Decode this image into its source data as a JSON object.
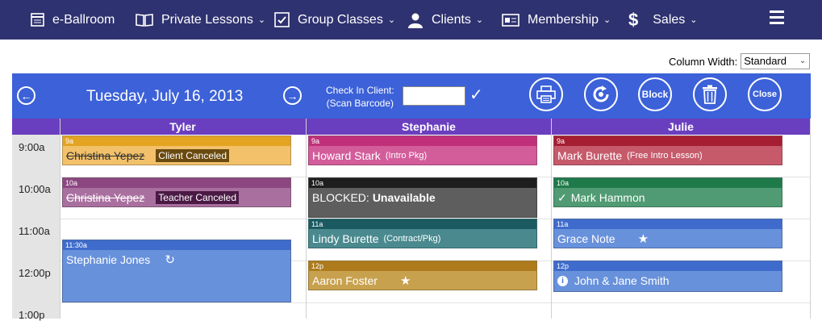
{
  "nav": {
    "brand": "e-Ballroom",
    "items": [
      "Private Lessons",
      "Group Classes",
      "Clients",
      "Membership",
      "Sales"
    ]
  },
  "column_width": {
    "label": "Column Width:",
    "value": "Standard"
  },
  "toolbar": {
    "date": "Tuesday, July 16, 2013",
    "checkin_line1": "Check In Client:",
    "checkin_line2": "(Scan Barcode)",
    "block_label": "Block",
    "close_label": "Close"
  },
  "columns": [
    "Tyler",
    "Stephanie",
    "Julie"
  ],
  "times": [
    "9:00a",
    "10:00a",
    "11:00a",
    "12:00p",
    "1:00p"
  ],
  "appointments": {
    "tyler": [
      {
        "time": "9a",
        "name": "Christina Yepez",
        "badge": "Client Canceled"
      },
      {
        "time": "10a",
        "name": "Christina Yepez",
        "badge": "Teacher Canceled"
      },
      {
        "time": "11:30a",
        "name": "Stephanie Jones"
      }
    ],
    "stephanie": [
      {
        "time": "9a",
        "name": "Howard Stark",
        "sub": "(Intro Pkg)"
      },
      {
        "time": "10a",
        "name": "BLOCKED:",
        "bold": "Unavailable"
      },
      {
        "time": "11a",
        "name": "Lindy Burette",
        "sub": "(Contract/Pkg)"
      },
      {
        "time": "12p",
        "name": "Aaron Foster"
      }
    ],
    "julie": [
      {
        "time": "9a",
        "name": "Mark Burette",
        "sub": "(Free Intro Lesson)"
      },
      {
        "time": "10a",
        "name": "Mark Hammon"
      },
      {
        "time": "11a",
        "name": "Grace Note"
      },
      {
        "time": "12p",
        "name": "John & Jane Smith"
      }
    ]
  }
}
